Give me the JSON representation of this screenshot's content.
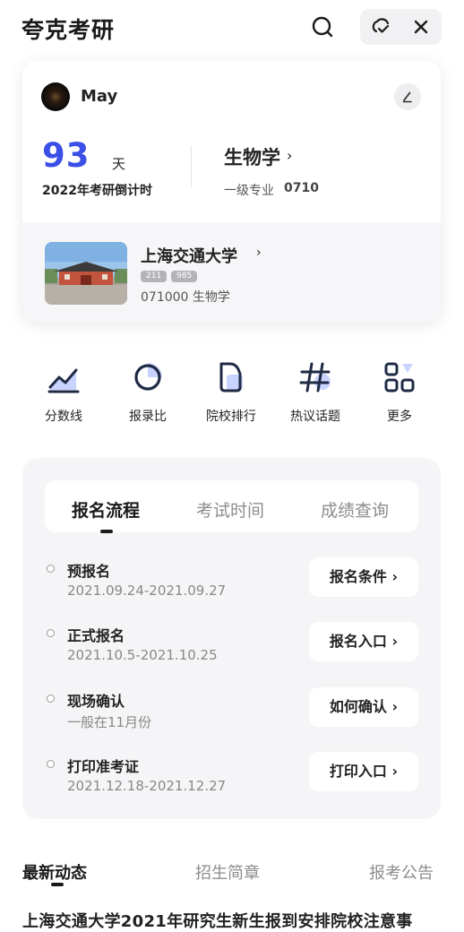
{
  "header": {
    "app_title": "夸克考研"
  },
  "profile": {
    "username": "May",
    "countdown_days": "93",
    "countdown_unit": "天",
    "countdown_label": "2022年考研倒计时",
    "major_name": "生物学",
    "major_chevron": "›",
    "major_level": "一级专业",
    "major_code": "0710"
  },
  "school": {
    "name": "上海交通大学",
    "chevron": "›",
    "tags": [
      "211",
      "985"
    ],
    "major_line": "071000 生物学"
  },
  "shortcuts": [
    {
      "label": "分数线",
      "icon": "trend-line-icon"
    },
    {
      "label": "报录比",
      "icon": "pie-ring-icon"
    },
    {
      "label": "院校排行",
      "icon": "document-icon"
    },
    {
      "label": "热议话题",
      "icon": "hashtag-icon"
    },
    {
      "label": "更多",
      "icon": "grid-more-icon"
    }
  ],
  "process": {
    "tabs": [
      "报名流程",
      "考试时间",
      "成绩查询"
    ],
    "active_tab": "报名流程",
    "steps": [
      {
        "title": "预报名",
        "date": "2021.09.24-2021.09.27",
        "action": "报名条件 ›"
      },
      {
        "title": "正式报名",
        "date": "2021.10.5-2021.10.25",
        "action": "报名入口 ›"
      },
      {
        "title": "现场确认",
        "date": "一般在11月份",
        "action": "如何确认 ›"
      },
      {
        "title": "打印准考证",
        "date": "2021.12.18-2021.12.27",
        "action": "打印入口 ›"
      }
    ]
  },
  "news": {
    "tabs": [
      "最新动态",
      "招生简章",
      "报考公告"
    ],
    "active_tab": "最新动态",
    "first_item_partial": "上海交通大学2021年研究生新生报到安排院校注意事"
  },
  "colors": {
    "accent": "#3a4fe6",
    "accent_light": "#c9d3ff",
    "panel_bg": "#f5f5f7"
  }
}
